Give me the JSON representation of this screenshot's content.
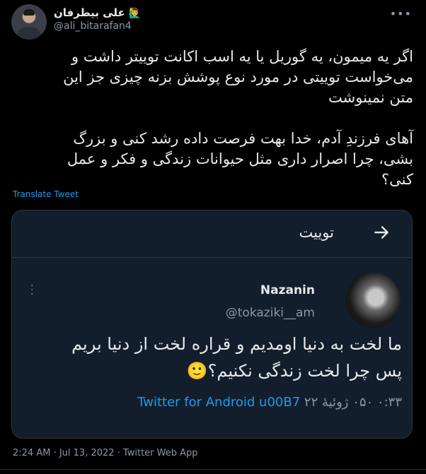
{
  "author": {
    "name": "علی بیطرفان",
    "badge_emoji": "🙋‍♂️",
    "handle": "@ali_bitarafan4"
  },
  "tweet": {
    "text": "اگر یه میمون، یه گوریل یا یه اسب اکانت توییتر داشت و\nمی‌خواست توییتی در مورد نوع پوشش بزنه چیزی جز این\nمتن نمینوشت\n\nآهای فرزندِ آدم، خدا بهت فرصت داده رشد کنی و بزرگ\nبشی، چرا اصرار داری مثل حیوانات زندگی و فکر و عمل\nکنی؟",
    "translate_label": "Translate Tweet"
  },
  "quoted": {
    "header_title": "توییت",
    "name": "Nazanin",
    "handle": "@tokaziki__am",
    "text": "ما لخت به دنیا اومدیم و قراره لخت از دنیا بریم\nپس چرا لخت زندگی نکنیم؟🙂",
    "meta_time": "۰:۳۳ ۰۵۰ ژوئیهٔ ۲۲",
    "meta_source": "Twitter for Android u00B7"
  },
  "footer": {
    "timestamp": "2:24 AM · Jul 13, 2022 · Twitter Web App"
  },
  "colors": {
    "background": "#000000",
    "accent": "#1d9bf0",
    "card": "#121e2b"
  }
}
